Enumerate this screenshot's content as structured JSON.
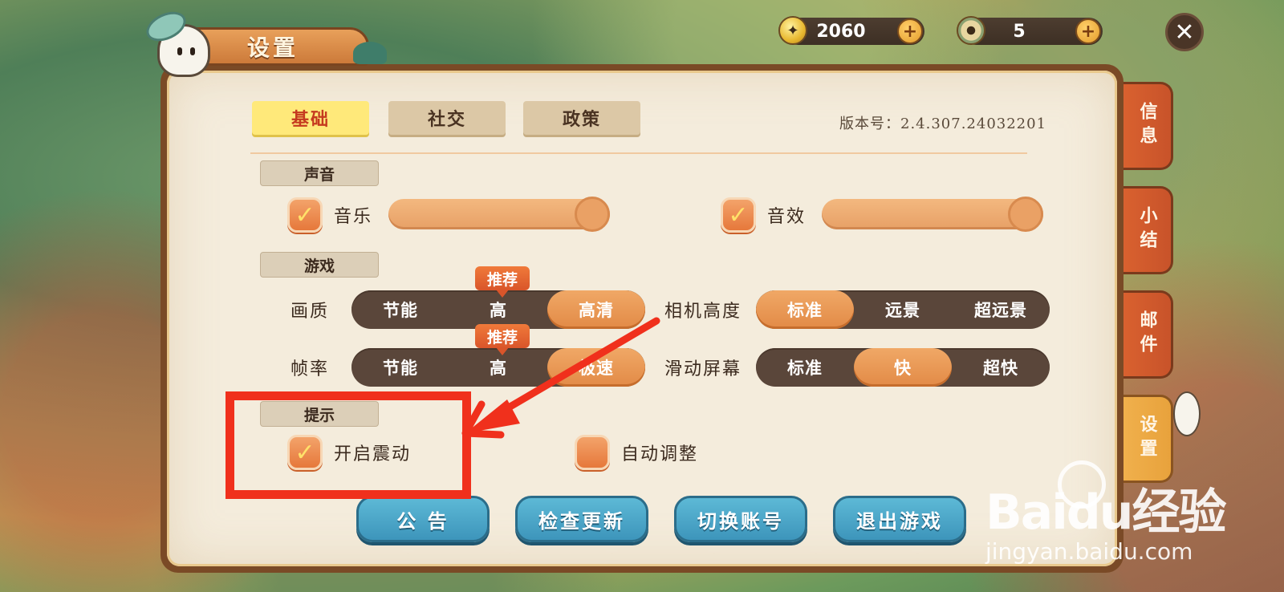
{
  "header": {
    "title": "设置",
    "currency_a": "2060",
    "currency_b": "5",
    "close_icon": "✕",
    "plus_icon": "+"
  },
  "tabs": [
    "基础",
    "社交",
    "政策"
  ],
  "active_tab": "基础",
  "version_label": "版本号：2.4.307.24032201",
  "sections": {
    "sound": "声音",
    "game": "游戏",
    "hint": "提示"
  },
  "sound": {
    "music": {
      "label": "音乐",
      "checked": true,
      "level": 1.0
    },
    "sfx": {
      "label": "音效",
      "checked": true,
      "level": 1.0
    }
  },
  "game": {
    "quality": {
      "label": "画质",
      "options": [
        "节能",
        "高",
        "高清"
      ],
      "selected": "高清",
      "recommended": "高"
    },
    "framerate": {
      "label": "帧率",
      "options": [
        "节能",
        "高",
        "极速"
      ],
      "selected": "极速",
      "recommended": "高"
    },
    "camera": {
      "label": "相机高度",
      "options": [
        "标准",
        "远景",
        "超远景"
      ],
      "selected": "标准"
    },
    "scroll": {
      "label": "滑动屏幕",
      "options": [
        "标准",
        "快",
        "超快"
      ],
      "selected": "快"
    },
    "recommend_badge": "推荐"
  },
  "hint": {
    "vibration": {
      "label": "开启震动",
      "checked": true
    },
    "auto_adjust": {
      "label": "自动调整",
      "checked": false
    }
  },
  "buttons": [
    "公 告",
    "检查更新",
    "切换账号",
    "退出游戏"
  ],
  "side_tabs": [
    "信息",
    "小结",
    "邮件",
    "设置"
  ],
  "active_side_tab": "设置",
  "watermark": {
    "brand": "Baidu经验",
    "url": "jingyan.baidu.com"
  },
  "colors": {
    "accent": "#e6783b",
    "annotation": "#f0301c",
    "button": "#3d95bb"
  }
}
